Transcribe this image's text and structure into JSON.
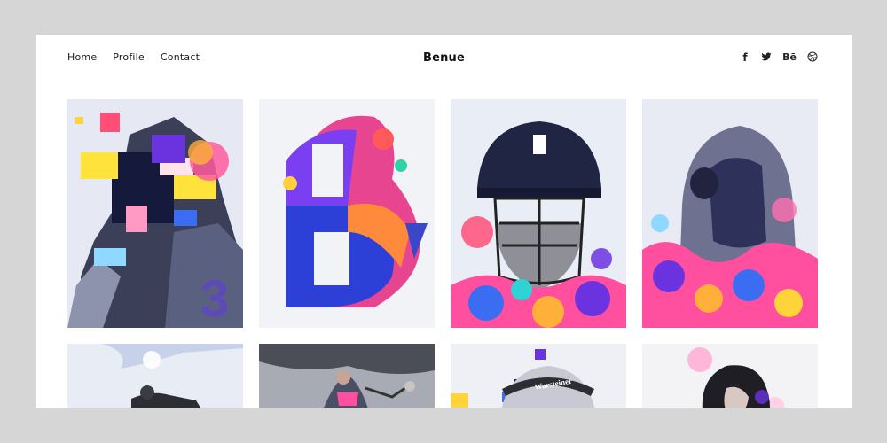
{
  "site": {
    "brand": "Benue"
  },
  "nav": {
    "items": [
      {
        "label": "Home"
      },
      {
        "label": "Profile"
      },
      {
        "label": "Contact"
      }
    ]
  },
  "social": {
    "icons": [
      "facebook-icon",
      "twitter-icon",
      "behance-icon",
      "dribbble-icon"
    ],
    "behance_label": "Bē"
  },
  "gallery": {
    "items": [
      {
        "subject": "glitch-portrait-number-3",
        "bg": "#e6e9f4"
      },
      {
        "subject": "paint-splash-letter-b",
        "bg": "#f2f3f7"
      },
      {
        "subject": "cricket-helmet-portrait",
        "bg": "#e9edf6"
      },
      {
        "subject": "hooded-figure-with-goggles",
        "bg": "#e8ebf4"
      },
      {
        "subject": "lying-figure-clouds",
        "bg": "#e7ecf5"
      },
      {
        "subject": "tennis-player-serving",
        "bg": "#d9dbe2"
      },
      {
        "subject": "cyclist-helmet-warsteiner",
        "bg": "#eef0f6"
      },
      {
        "subject": "woman-with-dark-hair",
        "bg": "#f3f2f4"
      }
    ]
  },
  "colors": {
    "background": "#d6d6d6",
    "page": "#ffffff",
    "text": "#1a1a1a"
  }
}
